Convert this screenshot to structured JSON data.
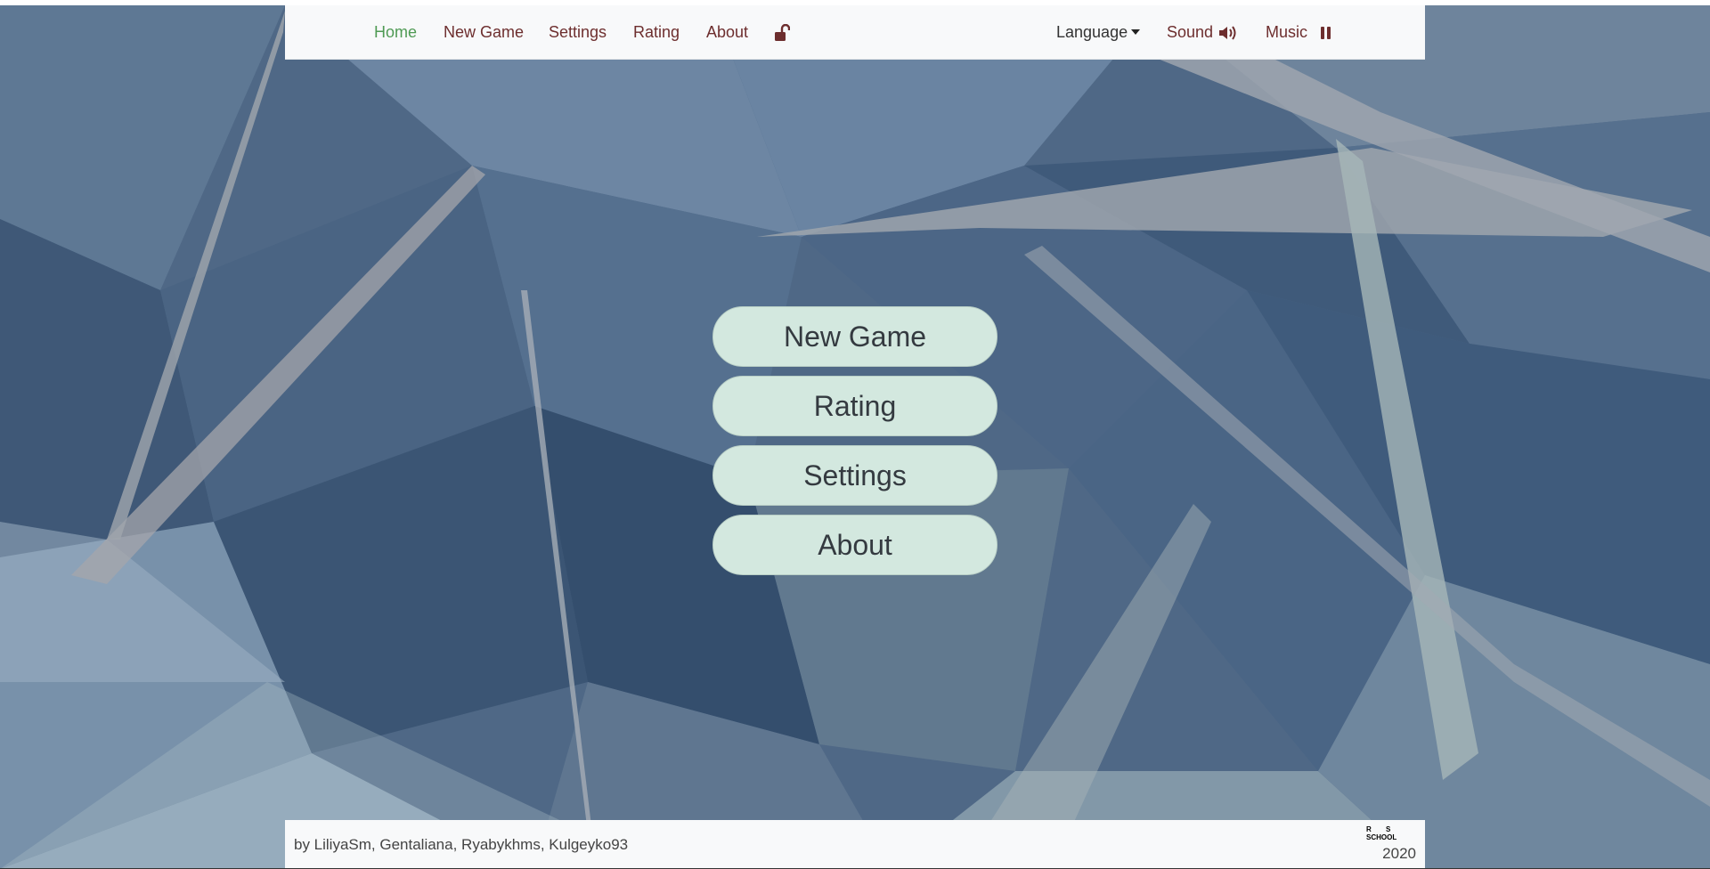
{
  "nav": {
    "home": "Home",
    "new_game": "New Game",
    "settings": "Settings",
    "rating": "Rating",
    "about": "About",
    "lock_icon": "unlock-icon",
    "language": "Language",
    "sound": "Sound",
    "sound_icon": "volume-icon",
    "music": "Music",
    "music_icon": "pause-icon"
  },
  "menu": {
    "new_game": "New Game",
    "rating": "Rating",
    "settings": "Settings",
    "about": "About"
  },
  "footer": {
    "authors": "by LiliyaSm, Gentaliana, Ryabykhms, Kulgeyko93",
    "year": "2020"
  },
  "colors": {
    "nav_link": "#6d2e2e",
    "nav_active": "#4f9a54",
    "button_bg": "#d3e8df",
    "background": "#4b6482"
  }
}
